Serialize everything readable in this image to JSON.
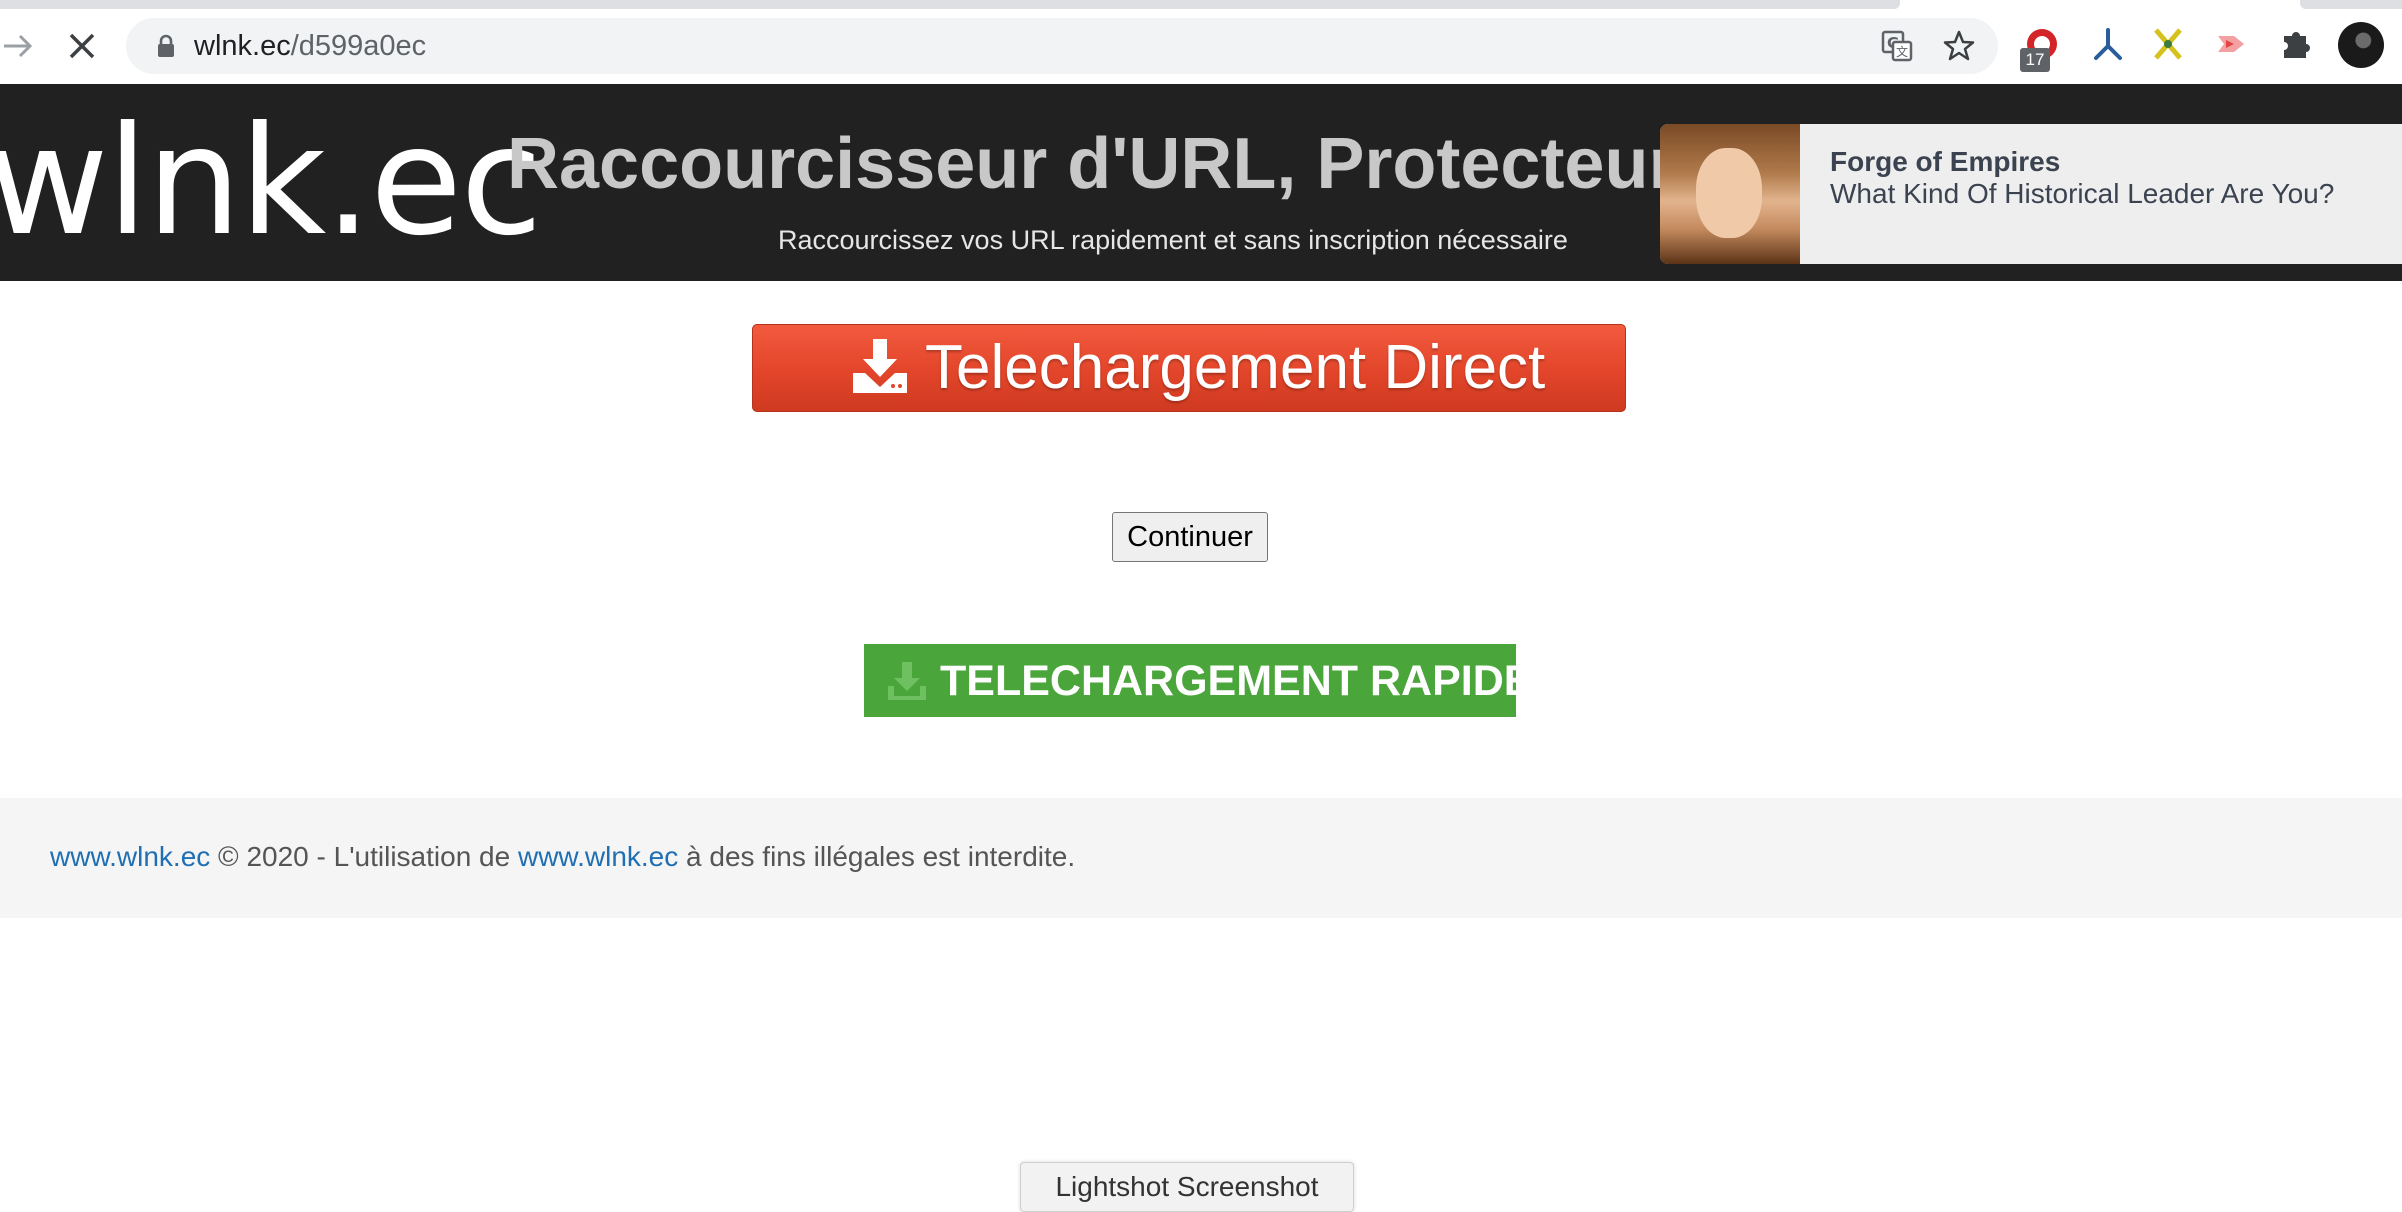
{
  "browser": {
    "url_host": "wlnk.ec",
    "url_path": "/d599a0ec",
    "extension_badge": "17"
  },
  "header": {
    "logo": "wlnk.ec",
    "title": "Raccourcisseur d'URL, Protecteur",
    "subtitle": "Raccourcissez vos URL rapidement et sans inscription nécessaire"
  },
  "ad": {
    "title": "Forge of Empires",
    "text": "What Kind Of Historical Leader Are You?"
  },
  "main": {
    "direct_label": "Telechargement Direct",
    "continue_label": "Continuer",
    "rapid_label": "TELECHARGEMENT RAPIDE"
  },
  "footer": {
    "link1": "www.wlnk.ec",
    "text1": " © 2020 - L'utilisation de ",
    "link2": "www.wlnk.ec",
    "text2": " à des fins illégales est interdite."
  },
  "lightshot": "Lightshot Screenshot",
  "colors": {
    "header_bg": "#212121",
    "direct_button": "#e2452a",
    "rapid_button": "#4aa53a",
    "footer_link": "#1f6fb2"
  }
}
